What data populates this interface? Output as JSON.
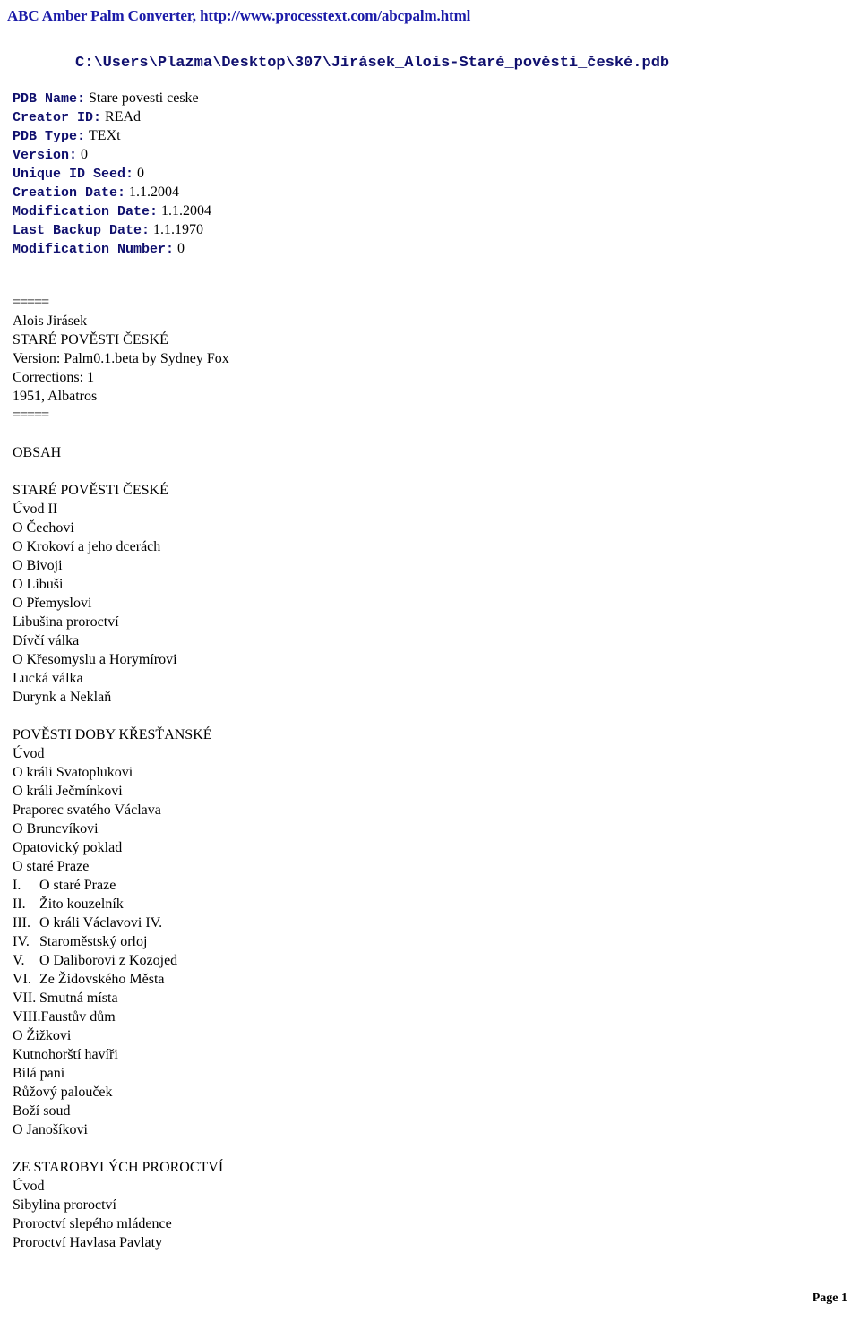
{
  "header": {
    "converter_link": "ABC Amber Palm Converter, http://www.processtext.com/abcpalm.html",
    "link_color": "#1a1aa8"
  },
  "file_path": "C:\\Users\\Plazma\\Desktop\\307\\Jirásek_Alois-Staré_pověsti_české.pdb",
  "metadata": {
    "label_color": "#10106e",
    "rows": [
      {
        "label": "PDB Name:",
        "value": "Stare povesti ceske"
      },
      {
        "label": "Creator ID:",
        "value": "REAd"
      },
      {
        "label": "PDB Type:",
        "value": "TEXt"
      },
      {
        "label": "Version:",
        "value": "0"
      },
      {
        "label": "Unique ID Seed:",
        "value": "0"
      },
      {
        "label": "Creation Date:",
        "value": "1.1.2004"
      },
      {
        "label": "Modification Date:",
        "value": "1.1.2004"
      },
      {
        "label": "Last Backup Date:",
        "value": "1.1.1970"
      },
      {
        "label": "Modification Number:",
        "value": "0"
      }
    ]
  },
  "book": {
    "rule_top": "=====",
    "author": "Alois Jirásek",
    "title": "STARÉ POVĚSTI ČESKÉ",
    "version": "Version: Palm0.1.beta by Sydney Fox",
    "corrections": "Corrections: 1",
    "publication": "1951, Albatros",
    "rule_bottom": "====="
  },
  "contents": {
    "heading": "OBSAH",
    "sections": [
      {
        "title": "STARÉ POVĚSTI ČESKÉ",
        "items": [
          {
            "num": "",
            "label": "Úvod II"
          },
          {
            "num": "",
            "label": "O Čechovi"
          },
          {
            "num": "",
            "label": "O Krokoví a jeho dcerách"
          },
          {
            "num": "",
            "label": "O Bivoji"
          },
          {
            "num": "",
            "label": "O Libuši"
          },
          {
            "num": "",
            "label": "O Přemyslovi"
          },
          {
            "num": "",
            "label": "Libušina proroctví"
          },
          {
            "num": "",
            "label": "Dívčí válka"
          },
          {
            "num": "",
            "label": "O Křesomyslu a Horymírovi"
          },
          {
            "num": "",
            "label": "Lucká válka"
          },
          {
            "num": "",
            "label": "Durynk a Neklaň"
          }
        ]
      },
      {
        "title": "POVĚSTI DOBY KŘESŤANSKÉ",
        "items": [
          {
            "num": "",
            "label": "Úvod"
          },
          {
            "num": "",
            "label": "O králi Svatoplukovi"
          },
          {
            "num": "",
            "label": "O králi Ječmínkovi"
          },
          {
            "num": "",
            "label": "Praporec svatého Václava"
          },
          {
            "num": "",
            "label": "O Bruncvíkovi"
          },
          {
            "num": "",
            "label": "Opatovický poklad"
          },
          {
            "num": "",
            "label": "O staré Praze"
          },
          {
            "num": "I.",
            "label": "O staré Praze"
          },
          {
            "num": "II.",
            "label": "Žito kouzelník"
          },
          {
            "num": "III.",
            "label": "O králi Václavovi IV."
          },
          {
            "num": "IV.",
            "label": "Staroměstský orloj"
          },
          {
            "num": "V.",
            "label": "O Daliborovi z Kozojed"
          },
          {
            "num": "VI.",
            "label": "Ze Židovského Města"
          },
          {
            "num": "VII.",
            "label": "Smutná místa"
          },
          {
            "num": "VIII.",
            "label": "Faustův dům"
          },
          {
            "num": "",
            "label": "O Žižkovi"
          },
          {
            "num": "",
            "label": "Kutnohorští havíři"
          },
          {
            "num": "",
            "label": "Bílá paní"
          },
          {
            "num": "",
            "label": "Růžový palouček"
          },
          {
            "num": "",
            "label": "Boží soud"
          },
          {
            "num": "",
            "label": "O Janošíkovi"
          }
        ]
      },
      {
        "title": "ZE STAROBYLÝCH PROROCTVÍ",
        "items": [
          {
            "num": "",
            "label": "Úvod"
          },
          {
            "num": "",
            "label": "Sibylina proroctví"
          },
          {
            "num": "",
            "label": "Proroctví slepého mládence"
          },
          {
            "num": "",
            "label": "Proroctví Havlasa Pavlaty"
          }
        ]
      }
    ]
  },
  "footer": {
    "page_label": "Page 1"
  }
}
